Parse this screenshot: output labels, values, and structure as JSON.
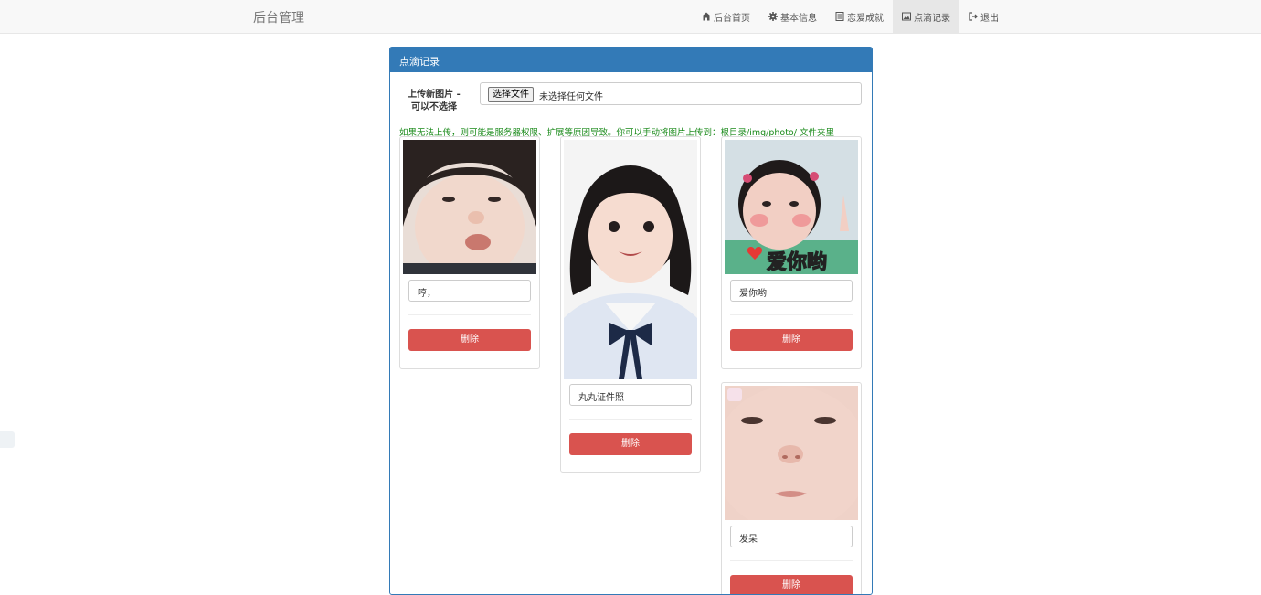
{
  "brand": "后台管理",
  "nav": [
    {
      "label": "后台首页",
      "icon": "home-icon"
    },
    {
      "label": "基本信息",
      "icon": "gear-icon"
    },
    {
      "label": "恋爱成就",
      "icon": "list-icon"
    },
    {
      "label": "点滴记录",
      "icon": "picture-icon",
      "active": true
    },
    {
      "label": "退出",
      "icon": "logout-icon"
    }
  ],
  "panel": {
    "title": "点滴记录",
    "upload_label_line1": "上传新图片 -",
    "upload_label_line2": "可以不选择",
    "file_button": "选择文件",
    "file_status": "未选择任何文件",
    "hint": "如果无法上传，则可能是服务器权限、扩展等原因导致。你可以手动将图片上传到：根目录/img/photo/ 文件夹里"
  },
  "cards": [
    {
      "caption": "哼，",
      "delete_label": "删除"
    },
    {
      "caption": "丸丸证件照",
      "delete_label": "删除"
    },
    {
      "caption": "爱你哟",
      "delete_label": "删除",
      "image_text": "爱你哟"
    },
    {
      "caption": "发呆",
      "delete_label": "删除"
    }
  ],
  "colors": {
    "primary": "#337ab7",
    "danger": "#d9534f",
    "hint": "#1a8a1a"
  }
}
